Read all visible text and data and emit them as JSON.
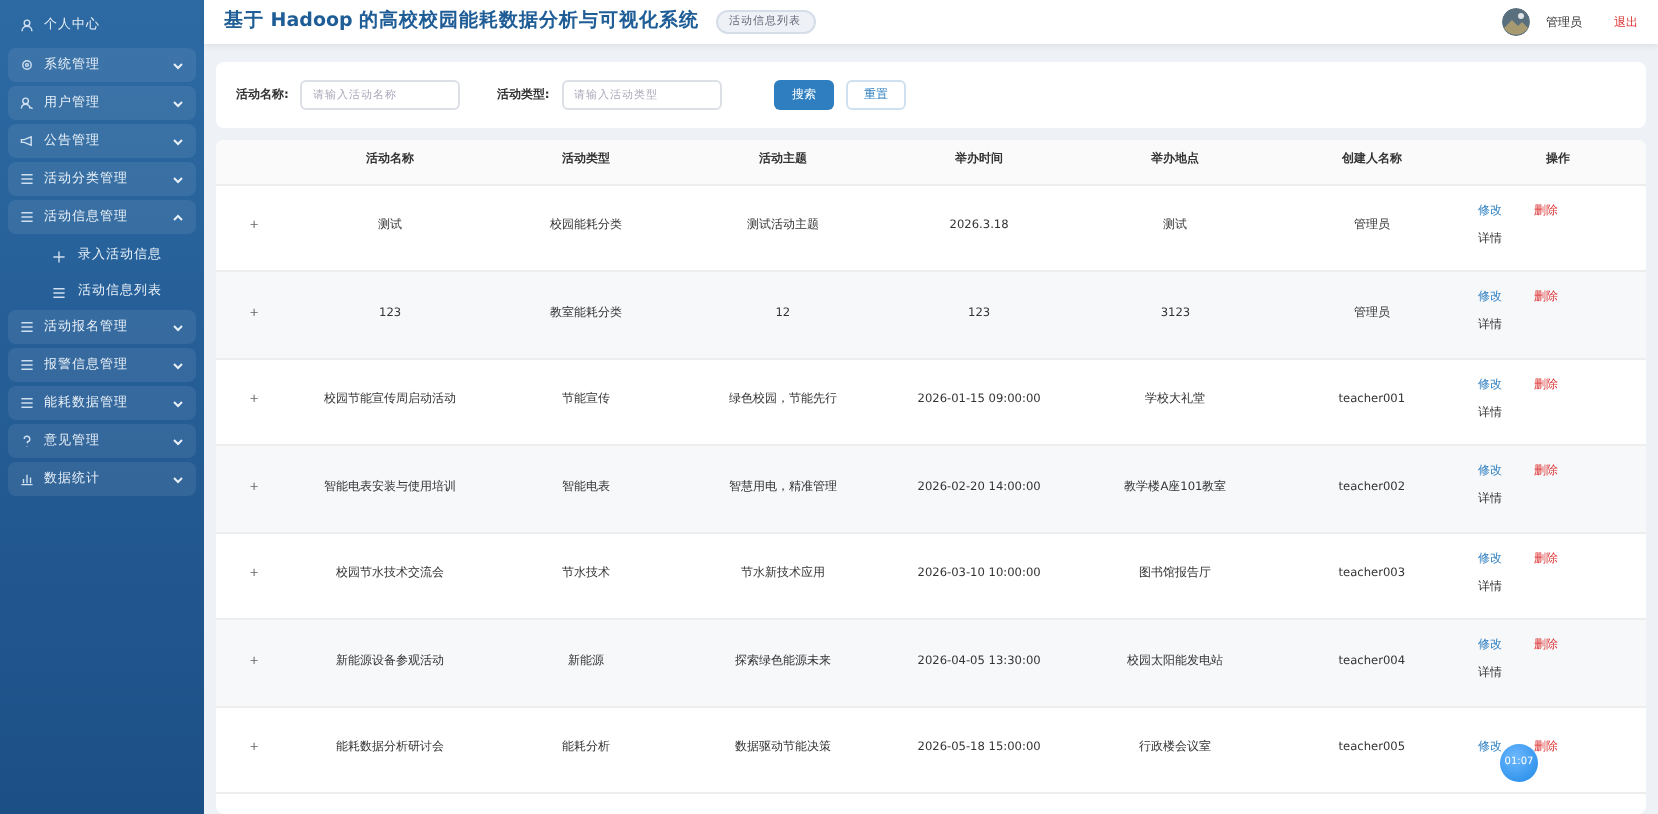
{
  "sidebar": {
    "top_item": {
      "label": "个人中心"
    },
    "items": [
      {
        "label": "系统管理",
        "expanded": false
      },
      {
        "label": "用户管理",
        "expanded": false
      },
      {
        "label": "公告管理",
        "expanded": false
      },
      {
        "label": "活动分类管理",
        "expanded": false
      },
      {
        "label": "活动信息管理",
        "expanded": true,
        "children": [
          {
            "label": "录入活动信息"
          },
          {
            "label": "活动信息列表"
          }
        ]
      },
      {
        "label": "活动报名管理",
        "expanded": false
      },
      {
        "label": "报警信息管理",
        "expanded": false
      },
      {
        "label": "能耗数据管理",
        "expanded": false
      },
      {
        "label": "意见管理",
        "expanded": false
      },
      {
        "label": "数据统计",
        "expanded": false
      }
    ]
  },
  "header": {
    "title": "基于 Hadoop 的高校校园能耗数据分析与可视化系统",
    "page_badge": "活动信息列表",
    "user": "管理员",
    "logout": "退出"
  },
  "search": {
    "fields": [
      {
        "label": "活动名称:",
        "placeholder": "请输入活动名称"
      },
      {
        "label": "活动类型:",
        "placeholder": "请输入活动类型"
      }
    ],
    "search_button": "搜索",
    "reset_button": "重置"
  },
  "table": {
    "columns": [
      "活动名称",
      "活动类型",
      "活动主题",
      "举办时间",
      "举办地点",
      "创建人名称",
      "操作"
    ],
    "rows": [
      {
        "expander": "+",
        "cells": [
          "测试",
          "校园能耗分类",
          "测试活动主题",
          "2026.3.18",
          "测试",
          "管理员"
        ],
        "edit": "修改",
        "delete": "删除",
        "details": "详情"
      },
      {
        "expander": "+",
        "cells": [
          "123",
          "教室能耗分类",
          "12",
          "123",
          "3123",
          "管理员"
        ],
        "edit": "修改",
        "delete": "删除",
        "details": "详情"
      },
      {
        "expander": "+",
        "cells": [
          "校园节能宣传周启动活动",
          "节能宣传",
          "绿色校园，节能先行",
          "2026-01-15 09:00:00",
          "学校大礼堂",
          "teacher001"
        ],
        "edit": "修改",
        "delete": "删除",
        "details": "详情"
      },
      {
        "expander": "+",
        "cells": [
          "智能电表安装与使用培训",
          "智能电表",
          "智慧用电，精准管理",
          "2026-02-20 14:00:00",
          "教学楼A座101教室",
          "teacher002"
        ],
        "edit": "修改",
        "delete": "删除",
        "details": "详情"
      },
      {
        "expander": "+",
        "cells": [
          "校园节水技术交流会",
          "节水技术",
          "节水新技术应用",
          "2026-03-10 10:00:00",
          "图书馆报告厅",
          "teacher003"
        ],
        "edit": "修改",
        "delete": "删除",
        "details": "详情"
      },
      {
        "expander": "+",
        "cells": [
          "新能源设备参观活动",
          "新能源",
          "探索绿色能源未来",
          "2026-04-05 13:30:00",
          "校园太阳能发电站",
          "teacher004"
        ],
        "edit": "修改",
        "delete": "删除",
        "details": "详情"
      },
      {
        "expander": "+",
        "cells": [
          "能耗数据分析研讨会",
          "能耗分析",
          "数据驱动节能决策",
          "2026-05-18 15:00:00",
          "行政楼会议室",
          "teacher005"
        ],
        "edit": "修改",
        "delete": "删除"
      }
    ]
  },
  "timer": "01:07"
}
